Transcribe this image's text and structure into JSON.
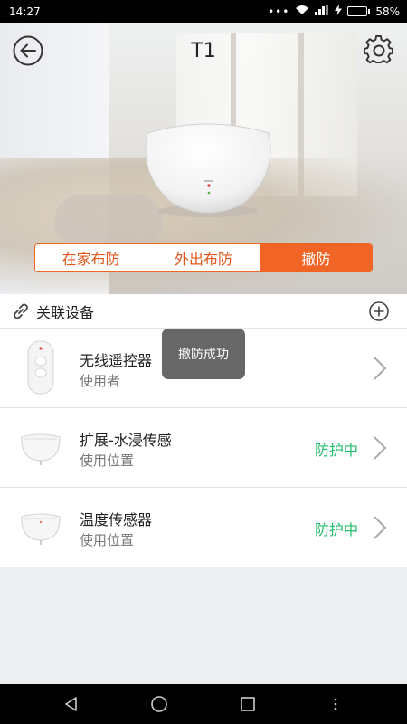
{
  "status_bar": {
    "time": "14:27",
    "battery": "58%",
    "battery_level": 0.58,
    "icons": [
      "dots-icon",
      "wifi-icon",
      "signal-icon",
      "charging-icon",
      "battery-icon"
    ]
  },
  "header": {
    "title": "T1",
    "back_icon": "back-arrow-icon",
    "settings_icon": "gear-icon"
  },
  "modes": {
    "items": [
      {
        "label": "在家布防",
        "active": false
      },
      {
        "label": "外出布防",
        "active": false
      },
      {
        "label": "撤防",
        "active": true
      }
    ],
    "accent": "#f06525"
  },
  "linked_devices": {
    "title": "关联设备",
    "icon": "link-icon",
    "add_icon": "add-circle-icon"
  },
  "devices": [
    {
      "name": "无线遥控器",
      "sub": "使用者",
      "status": ""
    },
    {
      "name": "扩展-水浸传感",
      "sub": "使用位置",
      "status": "防护中"
    },
    {
      "name": "温度传感器",
      "sub": "使用位置",
      "status": "防护中"
    }
  ],
  "toast": {
    "text": "撤防成功"
  },
  "status_color": "#22c06a"
}
